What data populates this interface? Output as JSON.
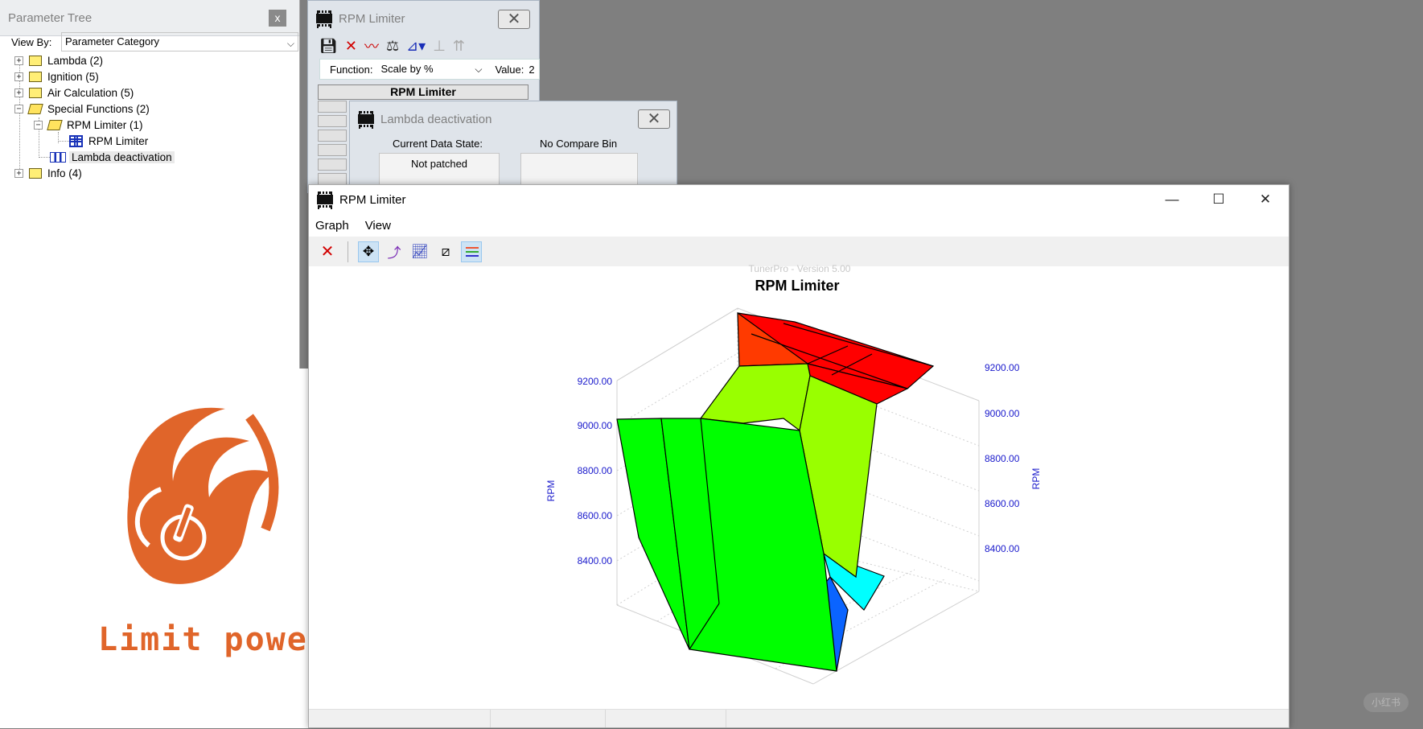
{
  "param_tree": {
    "title": "Parameter Tree",
    "close_label": "x",
    "view_by_label": "View By:",
    "view_by_value": "Parameter Category",
    "nodes": {
      "lambda": "Lambda  (2)",
      "ignition": "Ignition (5)",
      "air": "Air Calculation (5)",
      "special": "Special Functions (2)",
      "rpm_folder": "RPM Limiter (1)",
      "rpm_table": "RPM Limiter",
      "lambda_deact": "Lambda deactivation",
      "info": "Info (4)"
    }
  },
  "logo": {
    "brand": "Limit power"
  },
  "table_window": {
    "title": "RPM Limiter",
    "function_label": "Function:",
    "function_value": "Scale by %",
    "value_label": "Value:",
    "value_text": "2",
    "table_header": "RPM Limiter"
  },
  "lambda_window": {
    "title": "Lambda deactivation",
    "current_state_label": "Current Data State:",
    "current_state_value": "Not patched",
    "compare_label": "No Compare Bin"
  },
  "graph_window": {
    "title": "RPM Limiter",
    "menu": [
      "Graph",
      "View"
    ],
    "controls": {
      "minimize": "—",
      "maximize": "☐",
      "close": "✕"
    }
  },
  "colors": {
    "axis_blue": "#1a1acc",
    "surface_red": "#ff0000",
    "surface_orange": "#ff3a00",
    "surface_lime": "#99ff00",
    "surface_green": "#00ff00",
    "surface_cyan": "#00ffff",
    "surface_blue": "#0a64ff"
  },
  "chart_data": {
    "type": "surface3d",
    "watermark": "TunerPro - Version 5.00",
    "title": "RPM Limiter",
    "ylabel_left": "RPM",
    "ylabel_right": "RPM",
    "left_ticks": [
      "9200.00",
      "9000.00",
      "8800.00",
      "8600.00",
      "8400.00"
    ],
    "right_ticks": [
      "9200.00",
      "9000.00",
      "8800.00",
      "8600.00",
      "8400.00"
    ],
    "grid": true
  },
  "watermark_text": "小红书"
}
